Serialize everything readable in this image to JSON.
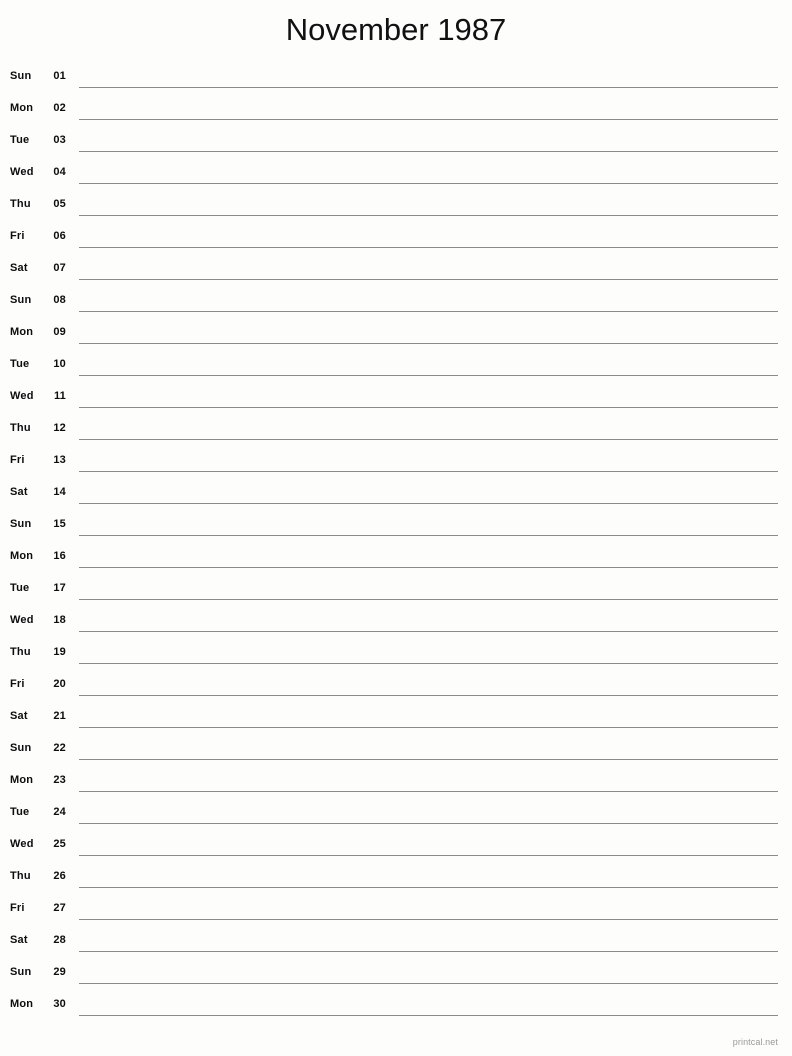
{
  "document": {
    "title": "November 1987",
    "month": "November",
    "year": "1987"
  },
  "colors": {
    "background": "#fdfdfb",
    "text": "#0d0d0d",
    "rule": "#8b8b8b",
    "footer_text": "#9a9a9a"
  },
  "days": [
    {
      "weekday": "Sun",
      "date": "01"
    },
    {
      "weekday": "Mon",
      "date": "02"
    },
    {
      "weekday": "Tue",
      "date": "03"
    },
    {
      "weekday": "Wed",
      "date": "04"
    },
    {
      "weekday": "Thu",
      "date": "05"
    },
    {
      "weekday": "Fri",
      "date": "06"
    },
    {
      "weekday": "Sat",
      "date": "07"
    },
    {
      "weekday": "Sun",
      "date": "08"
    },
    {
      "weekday": "Mon",
      "date": "09"
    },
    {
      "weekday": "Tue",
      "date": "10"
    },
    {
      "weekday": "Wed",
      "date": "11"
    },
    {
      "weekday": "Thu",
      "date": "12"
    },
    {
      "weekday": "Fri",
      "date": "13"
    },
    {
      "weekday": "Sat",
      "date": "14"
    },
    {
      "weekday": "Sun",
      "date": "15"
    },
    {
      "weekday": "Mon",
      "date": "16"
    },
    {
      "weekday": "Tue",
      "date": "17"
    },
    {
      "weekday": "Wed",
      "date": "18"
    },
    {
      "weekday": "Thu",
      "date": "19"
    },
    {
      "weekday": "Fri",
      "date": "20"
    },
    {
      "weekday": "Sat",
      "date": "21"
    },
    {
      "weekday": "Sun",
      "date": "22"
    },
    {
      "weekday": "Mon",
      "date": "23"
    },
    {
      "weekday": "Tue",
      "date": "24"
    },
    {
      "weekday": "Wed",
      "date": "25"
    },
    {
      "weekday": "Thu",
      "date": "26"
    },
    {
      "weekday": "Fri",
      "date": "27"
    },
    {
      "weekday": "Sat",
      "date": "28"
    },
    {
      "weekday": "Sun",
      "date": "29"
    },
    {
      "weekday": "Mon",
      "date": "30"
    }
  ],
  "footer": {
    "credit": "printcal.net"
  }
}
